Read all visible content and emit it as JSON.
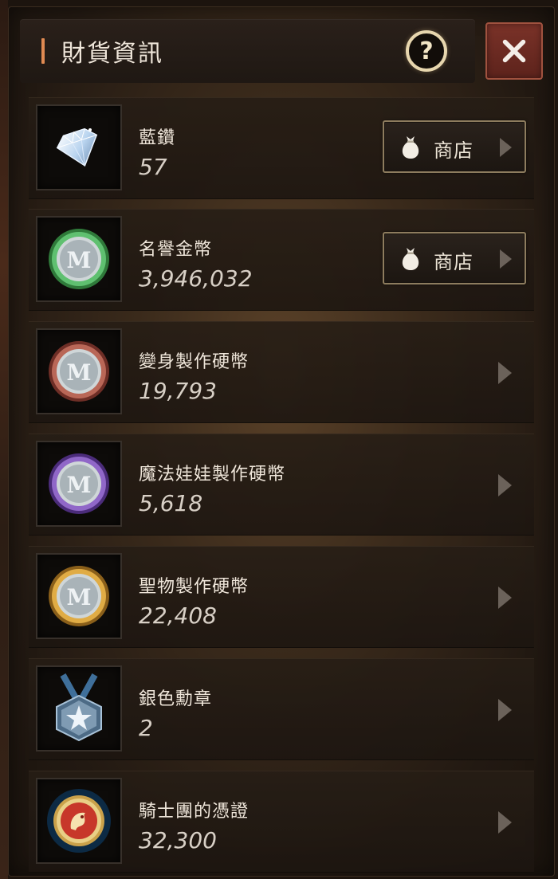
{
  "window": {
    "title": "財貨資訊",
    "help_symbol": "?"
  },
  "currencies": [
    {
      "name": "藍鑽",
      "value": "57",
      "icon": "blue-diamond-icon",
      "shop_label": "商店"
    },
    {
      "name": "名譽金幣",
      "value": "3,946,032",
      "icon": "green-coin-icon",
      "shop_label": "商店"
    },
    {
      "name": "變身製作硬幣",
      "value": "19,793",
      "icon": "red-coin-icon"
    },
    {
      "name": "魔法娃娃製作硬幣",
      "value": "5,618",
      "icon": "purple-coin-icon"
    },
    {
      "name": "聖物製作硬幣",
      "value": "22,408",
      "icon": "gold-coin-icon"
    },
    {
      "name": "銀色勳章",
      "value": "2",
      "icon": "silver-medal-icon"
    },
    {
      "name": "騎士團的憑證",
      "value": "32,300",
      "icon": "knight-emblem-icon"
    }
  ],
  "colors": {
    "accent": "#e08a52",
    "close_button": "#6d2a22",
    "green_coin_rim": "#3fa552",
    "red_coin_rim": "#a8584a",
    "purple_coin_rim": "#8a5cc0",
    "gold_coin_rim": "#d6a23c"
  }
}
